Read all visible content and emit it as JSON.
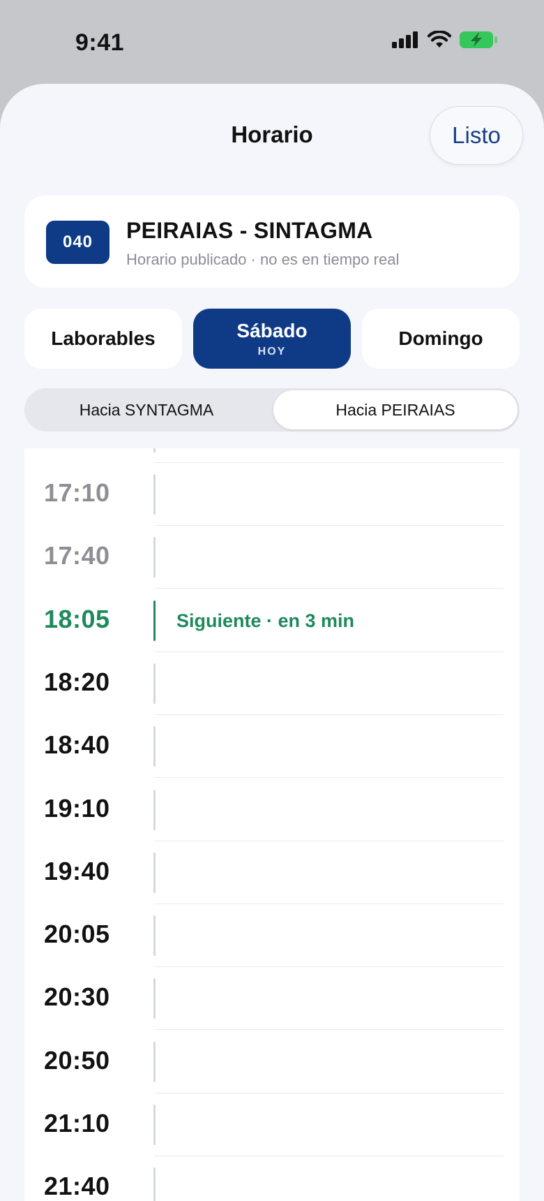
{
  "status_bar": {
    "time": "9:41"
  },
  "header": {
    "title": "Horario",
    "done_label": "Listo"
  },
  "route": {
    "number": "040",
    "name": "PEIRAIAS - SINTAGMA",
    "subtitle": "Horario publicado · no es en tiempo real"
  },
  "day_tabs": [
    {
      "label": "Laborables",
      "sub": ""
    },
    {
      "label": "Sábado",
      "sub": "HOY",
      "selected": true
    },
    {
      "label": "Domingo",
      "sub": ""
    }
  ],
  "directions": [
    {
      "label": "Hacia SYNTAGMA"
    },
    {
      "label": "Hacia PEIRAIAS",
      "selected": true
    }
  ],
  "departures": [
    {
      "time": "17:10",
      "state": "past",
      "note": ""
    },
    {
      "time": "17:40",
      "state": "past",
      "note": ""
    },
    {
      "time": "18:05",
      "state": "next",
      "note": "Siguiente · en 3 min"
    },
    {
      "time": "18:20",
      "state": "upcoming",
      "note": ""
    },
    {
      "time": "18:40",
      "state": "upcoming",
      "note": ""
    },
    {
      "time": "19:10",
      "state": "upcoming",
      "note": ""
    },
    {
      "time": "19:40",
      "state": "upcoming",
      "note": ""
    },
    {
      "time": "20:05",
      "state": "upcoming",
      "note": ""
    },
    {
      "time": "20:30",
      "state": "upcoming",
      "note": ""
    },
    {
      "time": "20:50",
      "state": "upcoming",
      "note": ""
    },
    {
      "time": "21:10",
      "state": "upcoming",
      "note": ""
    },
    {
      "time": "21:40",
      "state": "upcoming",
      "note": ""
    }
  ],
  "colors": {
    "accent": "#0f3a86",
    "next": "#1e8a5c",
    "battery": "#35c759"
  }
}
